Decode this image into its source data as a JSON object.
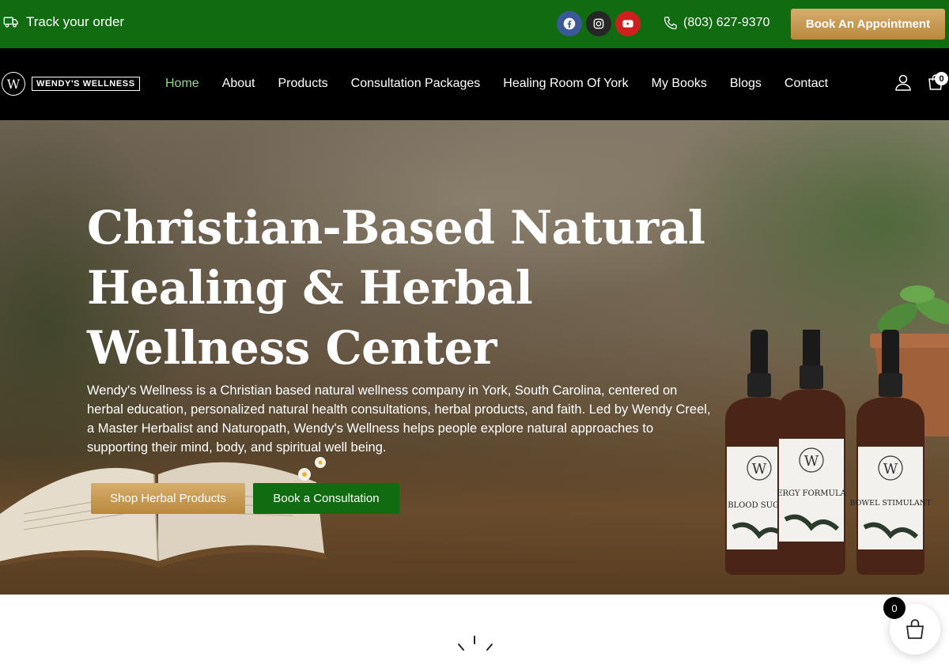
{
  "topbar": {
    "track_label": "Track your order",
    "track_icon": "truck-icon",
    "social": [
      "facebook-icon",
      "instagram-icon",
      "youtube-icon"
    ],
    "phone": "(803) 627-9370",
    "phone_icon": "phone-icon",
    "appointment_label": "Book An Appointment",
    "colors": {
      "green": "#116b11",
      "gold": "#c99b52"
    }
  },
  "nav": {
    "logo_mark": "W",
    "logo_text": "WENDY'S WELLNESS",
    "items": [
      {
        "label": "Home",
        "active": true
      },
      {
        "label": "About"
      },
      {
        "label": "Products"
      },
      {
        "label": "Consultation Packages"
      },
      {
        "label": "Healing Room Of York"
      },
      {
        "label": "My Books"
      },
      {
        "label": "Blogs"
      },
      {
        "label": "Contact"
      }
    ],
    "account_icon": "user-icon",
    "cart_icon": "shopping-bag-icon",
    "cart_count": "0"
  },
  "hero": {
    "title_lines": [
      "Christian-Based Natural",
      "Healing & Herbal",
      "Wellness Center"
    ],
    "description": "Wendy's Wellness is a Christian based natural wellness company in York, South Carolina, centered on herbal education, personalized natural health consultations, herbal products, and faith. Led by Wendy Creel, a Master Herbalist and Naturopath, Wendy's Wellness helps people explore natural approaches to supporting their mind, body, and spiritual well being.",
    "primary_button": "Shop Herbal Products",
    "secondary_button": "Book a Consultation",
    "bottle_labels": [
      "BLOOD SUGAR",
      "ERGY FORMULA",
      "BOWEL STIMULANT"
    ],
    "bottle_mark": "W"
  },
  "floating_cart": {
    "count": "0",
    "icon": "shopping-basket-icon"
  }
}
